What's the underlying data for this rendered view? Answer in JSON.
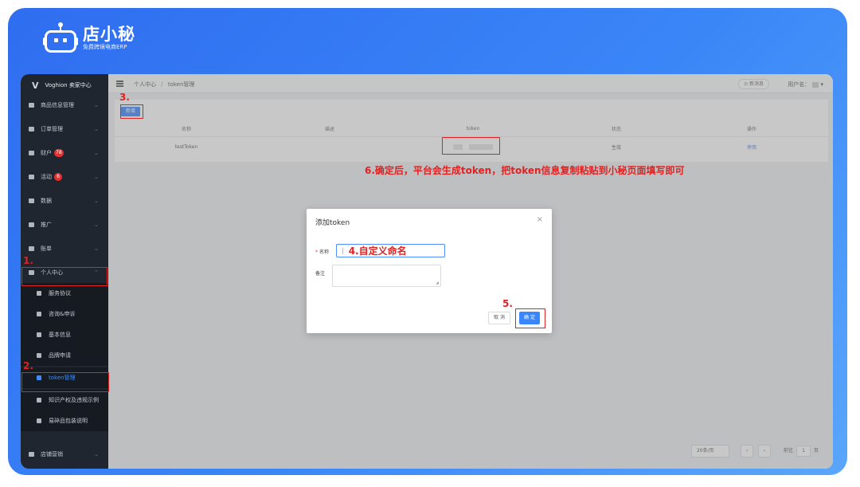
{
  "logo": {
    "name": "店小秘",
    "subtitle": "免费跨境电商ERP"
  },
  "sidebar": {
    "brand": "Voghion 卖家中心",
    "items": [
      {
        "label": "商品信息管理"
      },
      {
        "label": "订单管理"
      },
      {
        "label": "财户",
        "badge": "78"
      },
      {
        "label": "活动",
        "badge": "6"
      },
      {
        "label": "数据"
      },
      {
        "label": "推广"
      },
      {
        "label": "账单"
      },
      {
        "label": "个人中心"
      }
    ],
    "subitems": [
      {
        "label": "服务协议"
      },
      {
        "label": "咨询&申诉"
      },
      {
        "label": "基本信息"
      },
      {
        "label": "品牌申请"
      },
      {
        "label": "token管理"
      },
      {
        "label": "知识产权及违规示例"
      },
      {
        "label": "易碎品包装说明"
      }
    ],
    "last_item": {
      "label": "店铺营销"
    }
  },
  "topbar": {
    "crumb_root": "个人中心",
    "crumb_sep": "/",
    "crumb_current": "token管理",
    "msg_button": "⊙ 新消息",
    "user_label": "用户名："
  },
  "card": {
    "add_button": "新增",
    "columns": [
      "名称",
      "描述",
      "token",
      "状态",
      "操作"
    ],
    "row": {
      "name": "testToken",
      "desc": "",
      "status": "生效",
      "op": "停用"
    }
  },
  "pagination": {
    "page_size": "20条/页",
    "prev": "‹",
    "next": "›",
    "goto_label": "前往",
    "page": "1",
    "page_unit": "页"
  },
  "dialog": {
    "title": "添加token",
    "close": "×",
    "name_label": "名称",
    "name_value": "4.自定义命名",
    "remark_label": "备注",
    "cancel": "取 消",
    "confirm": "确 定"
  },
  "annotations": {
    "step1": "1.",
    "step2": "2.",
    "step3": "3.",
    "step5": "5.",
    "step6": "6.确定后，平台会生成token，把token信息复制粘贴到小秘页面填写即可"
  },
  "colors": {
    "accent": "#3a86ff",
    "annotation": "#e02222",
    "sidebar_bg": "#1f2630",
    "frame_bg": "#2f6df0"
  }
}
